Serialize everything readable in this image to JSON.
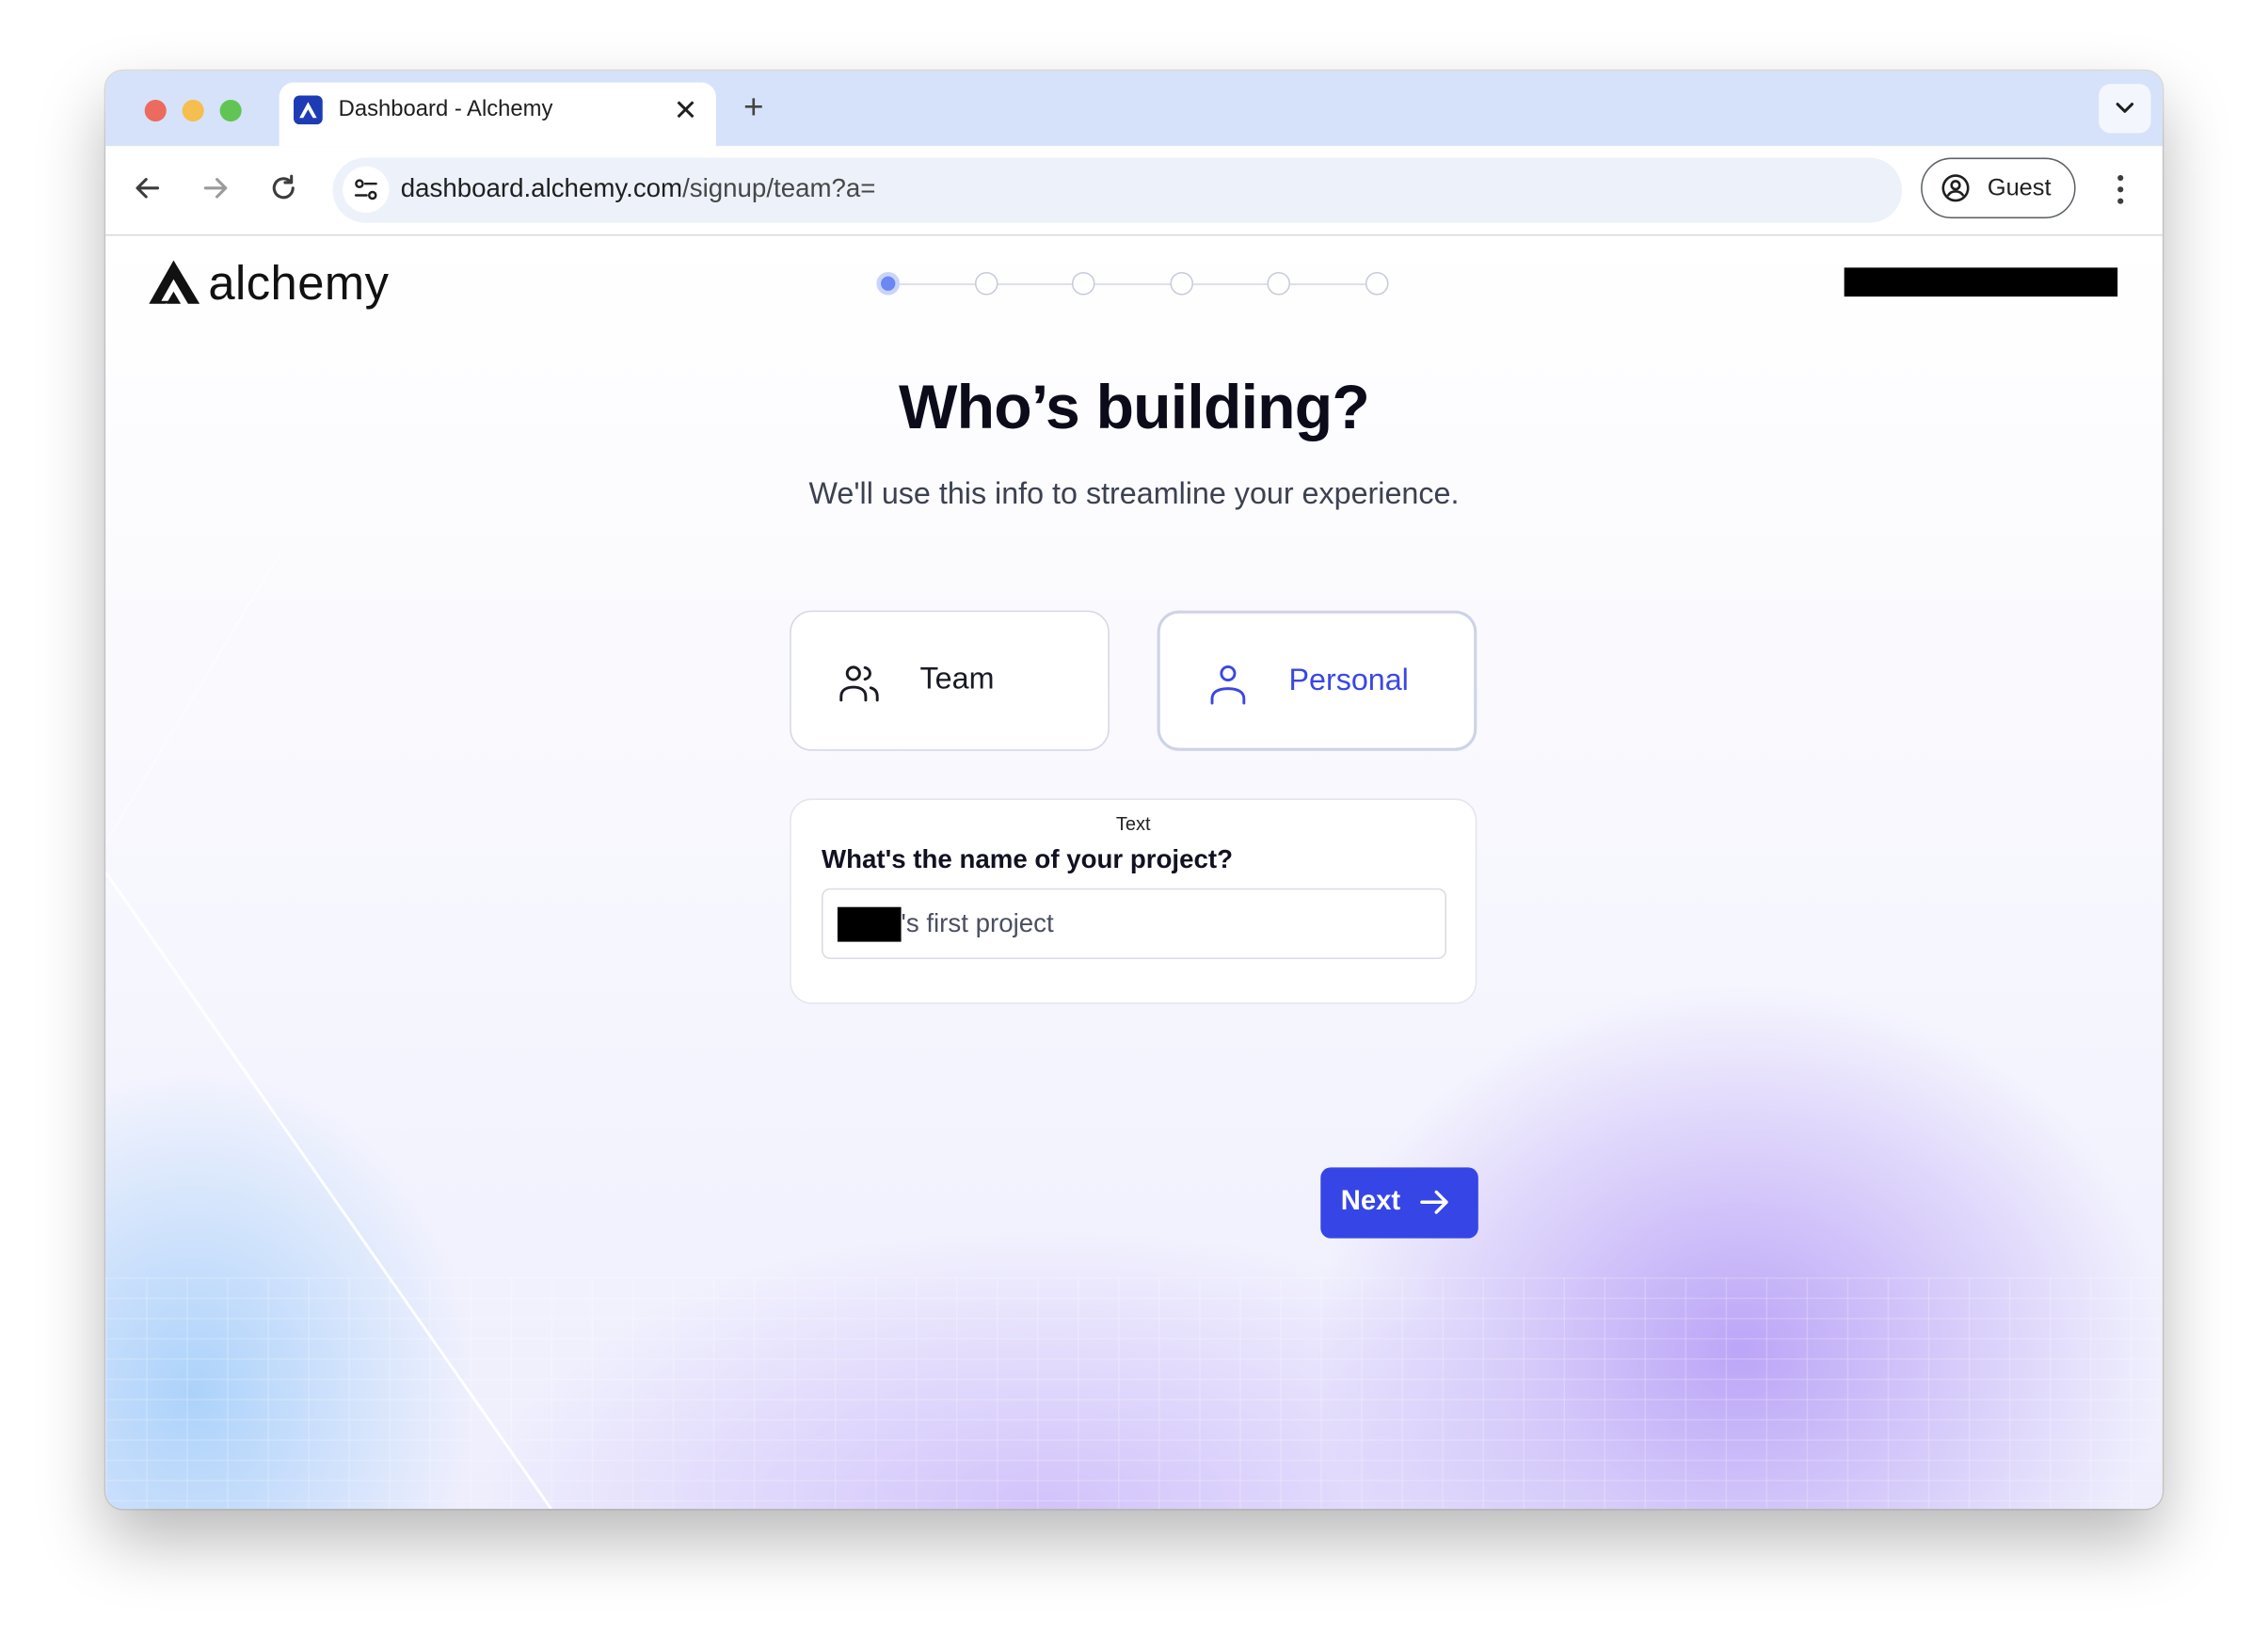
{
  "browser": {
    "tab": {
      "title": "Dashboard - Alchemy",
      "close_glyph": "✕"
    },
    "new_tab_glyph": "+",
    "url": {
      "host": "dashboard.alchemy.com",
      "path": "/signup/team?a="
    },
    "profile_label": "Guest"
  },
  "header": {
    "brand": "alchemy",
    "steps": {
      "total": 6,
      "current": 1
    }
  },
  "main": {
    "title": "Who’s building?",
    "subtitle": "We'll use this info to streamline your experience.",
    "options": {
      "team_label": "Team",
      "personal_label": "Personal",
      "selected": "Personal"
    },
    "project_card": {
      "caption": "Text",
      "question": "What's the name of your project?",
      "value_suffix": "'s first project"
    },
    "next_label": "Next"
  },
  "colors": {
    "accent": "#3645e6",
    "selected_text": "#3a47e3",
    "tab_strip": "#d6e2f9"
  },
  "icons": [
    "alchemy-favicon",
    "close-icon",
    "plus-icon",
    "chevron-down-icon",
    "back-arrow-icon",
    "forward-arrow-icon",
    "reload-icon",
    "site-settings-icon",
    "profile-icon",
    "kebab-menu-icon",
    "alchemy-logo-icon",
    "users-icon",
    "user-icon",
    "arrow-right-icon"
  ]
}
